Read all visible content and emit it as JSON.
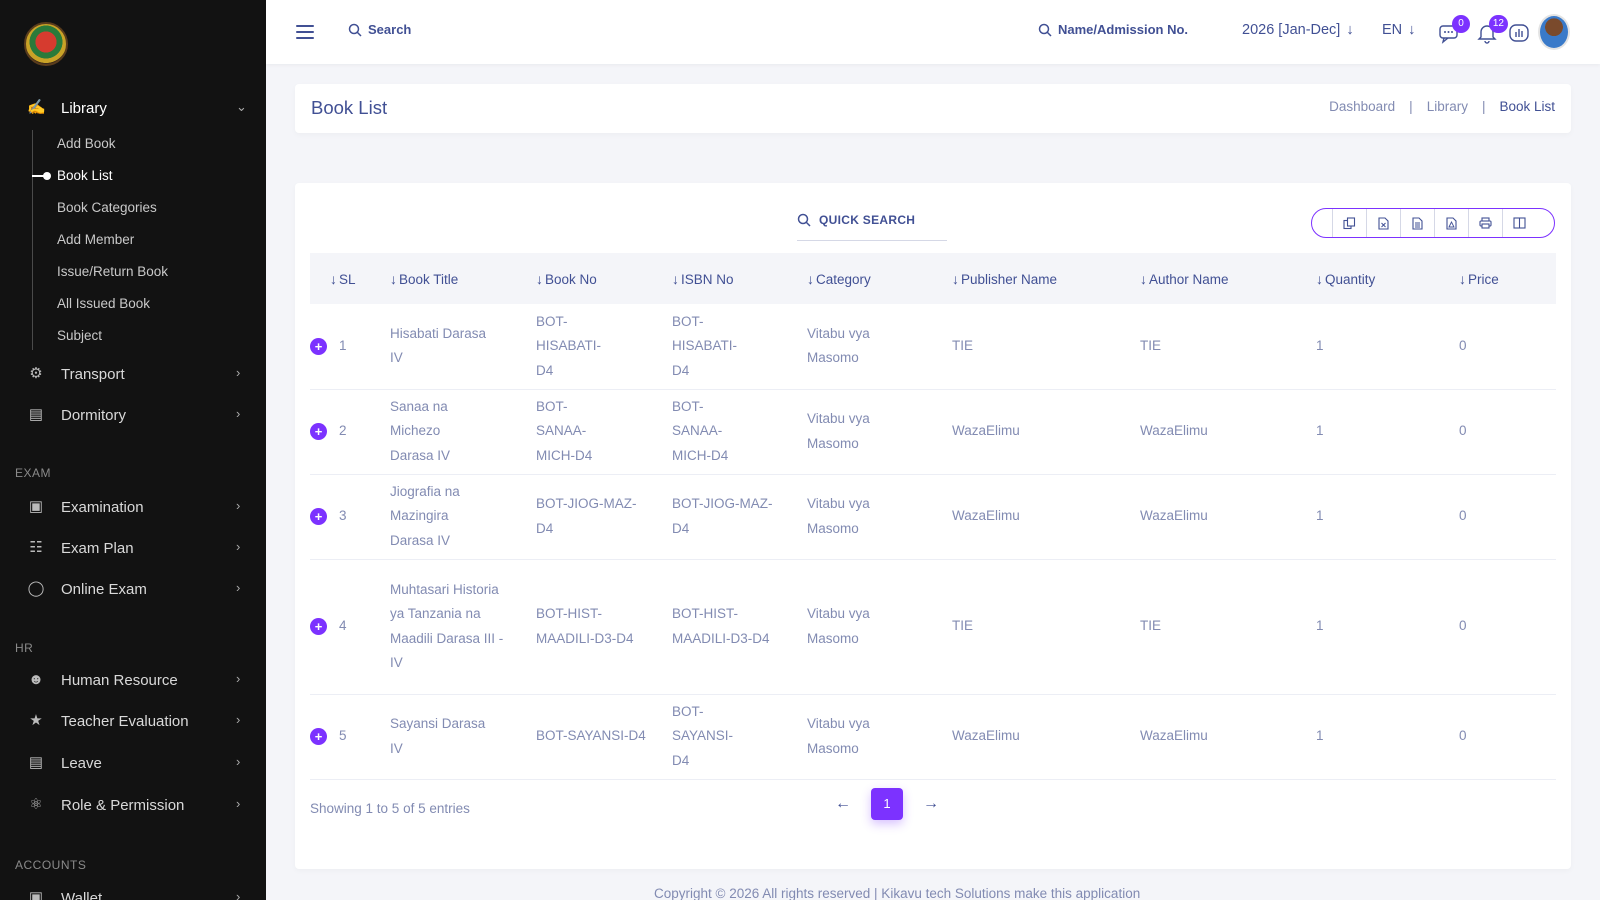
{
  "sidebar": {
    "library": {
      "label": "Library",
      "sub": [
        "Add Book",
        "Book List",
        "Book Categories",
        "Add Member",
        "Issue/Return Book",
        "All Issued Book",
        "Subject"
      ]
    },
    "transport": "Transport",
    "dormitory": "Dormitory",
    "exam_section": "EXAM",
    "examination": "Examination",
    "exam_plan": "Exam Plan",
    "online_exam": "Online Exam",
    "hr_section": "HR",
    "human_resource": "Human Resource",
    "teacher_evaluation": "Teacher Evaluation",
    "leave": "Leave",
    "role_permission": "Role & Permission",
    "accounts_section": "ACCOUNTS",
    "wallet": "Wallet"
  },
  "header": {
    "search": "Search",
    "name_search": "Name/Admission No.",
    "year": "2026 [Jan-Dec]",
    "lang": "EN",
    "chat_badge": "0",
    "notif_badge": "12"
  },
  "page": {
    "title": "Book List",
    "breadcrumbs": [
      "Dashboard",
      "Library",
      "Book List"
    ]
  },
  "table": {
    "quick_search": "QUICK SEARCH",
    "columns": [
      "SL",
      "Book Title",
      "Book No",
      "ISBN No",
      "Category",
      "Publisher Name",
      "Author Name",
      "Quantity",
      "Price"
    ],
    "rows": [
      {
        "sl": "1",
        "title": "Hisabati Darasa IV",
        "book_no": "BOT-HISABATI-D4",
        "isbn": "BOT-HISABATI-D4",
        "category": "Vitabu vya Masomo",
        "publisher": "TIE",
        "author": "TIE",
        "quantity": "1",
        "price": "0"
      },
      {
        "sl": "2",
        "title": "Sanaa na Michezo Darasa IV",
        "book_no": "BOT-SANAA-MICH-D4",
        "isbn": "BOT-SANAA-MICH-D4",
        "category": "Vitabu vya Masomo",
        "publisher": "WazaElimu",
        "author": "WazaElimu",
        "quantity": "1",
        "price": "0"
      },
      {
        "sl": "3",
        "title": "Jiografia na Mazingira Darasa IV",
        "book_no": "BOT-JIOG-MAZ-D4",
        "isbn": "BOT-JIOG-MAZ-D4",
        "category": "Vitabu vya Masomo",
        "publisher": "WazaElimu",
        "author": "WazaElimu",
        "quantity": "1",
        "price": "0"
      },
      {
        "sl": "4",
        "title": "Muhtasari Historia ya Tanzania na Maadili Darasa III - IV",
        "book_no": "BOT-HIST-MAADILI-D3-D4",
        "isbn": "BOT-HIST-MAADILI-D3-D4",
        "category": "Vitabu vya Masomo",
        "publisher": "TIE",
        "author": "TIE",
        "quantity": "1",
        "price": "0"
      },
      {
        "sl": "5",
        "title": "Sayansi Darasa IV",
        "book_no": "BOT-SAYANSI-D4",
        "isbn": "BOT-SAYANSI-D4",
        "category": "Vitabu vya Masomo",
        "publisher": "WazaElimu",
        "author": "WazaElimu",
        "quantity": "1",
        "price": "0"
      }
    ],
    "showing": "Showing 1 to 5 of 5 entries",
    "page": "1"
  },
  "footer": {
    "copyright": "Copyright © 2026 All rights reserved | Kikavu tech Solutions make this application"
  },
  "colors": {
    "accent": "#7c32ff",
    "text": "#415094",
    "muted": "#828bb2",
    "sidebar_bg": "#121212"
  }
}
